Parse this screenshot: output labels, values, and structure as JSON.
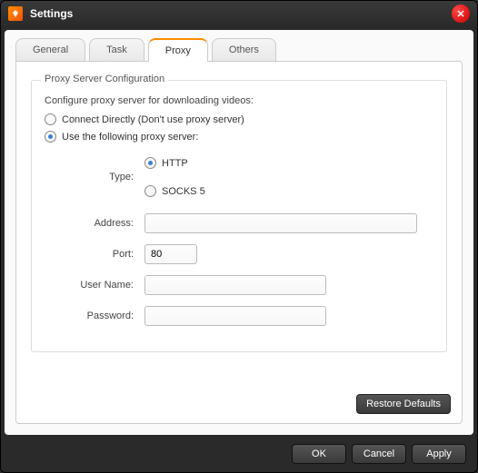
{
  "window": {
    "title": "Settings"
  },
  "tabs": [
    {
      "label": "General"
    },
    {
      "label": "Task"
    },
    {
      "label": "Proxy"
    },
    {
      "label": "Others"
    }
  ],
  "active_tab_index": 2,
  "proxy": {
    "fieldset_title": "Proxy Server Configuration",
    "description": "Configure proxy server for downloading videos:",
    "option_direct": "Connect Directly (Don't use proxy server)",
    "option_use_proxy": "Use the following proxy server:",
    "selected_mode": "use_proxy",
    "type_label": "Type:",
    "type_http": "HTTP",
    "type_socks5": "SOCKS 5",
    "selected_type": "http",
    "address_label": "Address:",
    "address_value": "",
    "port_label": "Port:",
    "port_value": "80",
    "username_label": "User Name:",
    "username_value": "",
    "password_label": "Password:",
    "password_value": ""
  },
  "buttons": {
    "restore_defaults": "Restore Defaults",
    "ok": "OK",
    "cancel": "Cancel",
    "apply": "Apply"
  }
}
